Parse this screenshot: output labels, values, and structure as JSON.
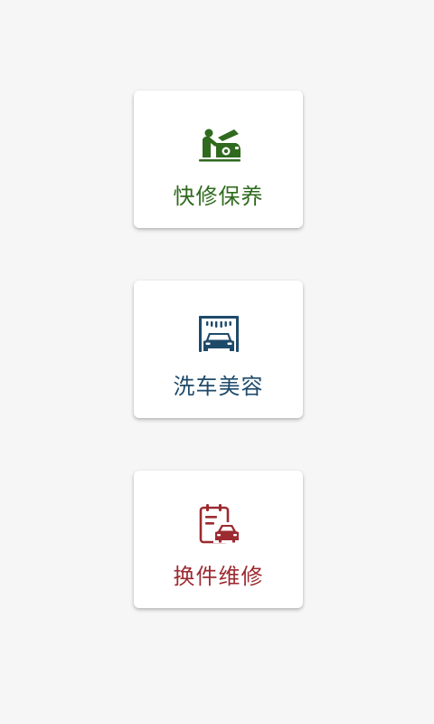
{
  "cards": [
    {
      "label": "快修保养",
      "icon": "car-repair-icon",
      "color": "#2f6a1e"
    },
    {
      "label": "洗车美容",
      "icon": "car-wash-icon",
      "color": "#1e4a6a"
    },
    {
      "label": "换件维修",
      "icon": "parts-replacement-icon",
      "color": "#9c2a30"
    }
  ]
}
